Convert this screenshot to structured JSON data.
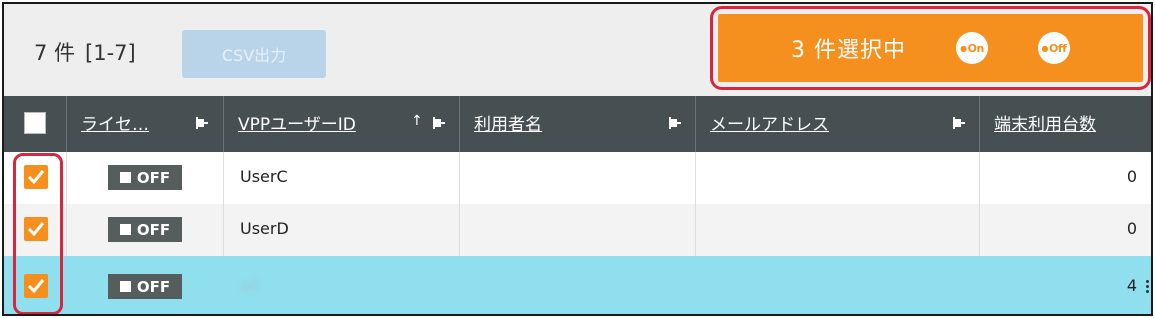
{
  "toolbar": {
    "count_label": "7 件",
    "range_label": "[1-7]",
    "csv_button": "CSV出力",
    "selected_text": "3 件選択中",
    "on_button": "On",
    "off_button": "Off"
  },
  "columns": [
    {
      "key": "license",
      "label": "ライセ…",
      "pinned": true
    },
    {
      "key": "vpp_user_id",
      "label": "VPPユーザーID",
      "pinned": true,
      "sort": "↑"
    },
    {
      "key": "user_name",
      "label": "利用者名",
      "pinned": true
    },
    {
      "key": "email",
      "label": "メールアドレス",
      "pinned": true
    },
    {
      "key": "device_count",
      "label": "端末利用台数",
      "pinned": false
    }
  ],
  "rows": [
    {
      "checked": true,
      "license": "OFF",
      "vpp_user_id": "UserC",
      "user_name": "",
      "email": "",
      "device_count": "0",
      "highlighted": false
    },
    {
      "checked": true,
      "license": "OFF",
      "vpp_user_id": "UserD",
      "user_name": "",
      "email": "",
      "device_count": "0",
      "highlighted": false
    },
    {
      "checked": true,
      "license": "OFF",
      "vpp_user_id": "all",
      "user_name": "",
      "email": "",
      "device_count": "4",
      "highlighted": true
    }
  ],
  "colors": {
    "accent_orange": "#f5901e",
    "header_bg": "#465052",
    "highlight_row": "#8fdfef",
    "annotation_red": "#d7263d",
    "csv_disabled": "#b9d3e9"
  },
  "icons": {
    "pin": "pin-icon",
    "checkmark": "checkmark-icon",
    "on": "power-on-icon",
    "off": "power-off-icon"
  }
}
